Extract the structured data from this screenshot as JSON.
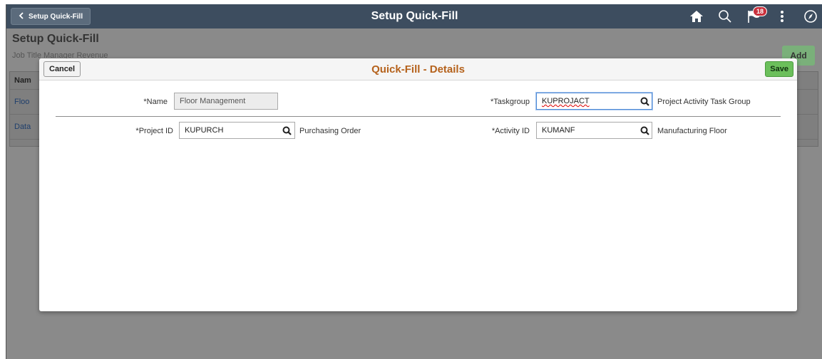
{
  "banner": {
    "back_label": "Setup Quick-Fill",
    "title": "Setup Quick-Fill",
    "notification_count": "18",
    "icons": [
      "home-icon",
      "search-icon",
      "notification-flag-icon",
      "actions-menu-icon",
      "navbar-compass-icon"
    ]
  },
  "page": {
    "title": "Setup Quick-Fill",
    "job_title": "Job Title  Manager Revenue",
    "add_label": "Add",
    "table": {
      "header": "Nam",
      "rows": [
        "Floo",
        "Data"
      ]
    }
  },
  "modal": {
    "title": "Quick-Fill - Details",
    "cancel_label": "Cancel",
    "save_label": "Save",
    "fields": {
      "name": {
        "label": "*Name",
        "value": "Floor Management"
      },
      "taskgroup": {
        "label": "*Taskgroup",
        "value": "KUPROJACT",
        "description": "Project Activity Task Group"
      },
      "project_id": {
        "label": "*Project ID",
        "value": "KUPURCH",
        "description": "Purchasing Order"
      },
      "activity_id": {
        "label": "*Activity ID",
        "value": "KUMANF",
        "description": "Manufacturing Floor"
      }
    }
  },
  "colors": {
    "banner": "#3d4d5f",
    "modal_title": "#b5621c",
    "save_button": "#6bbf5b",
    "badge": "#c9303c"
  }
}
